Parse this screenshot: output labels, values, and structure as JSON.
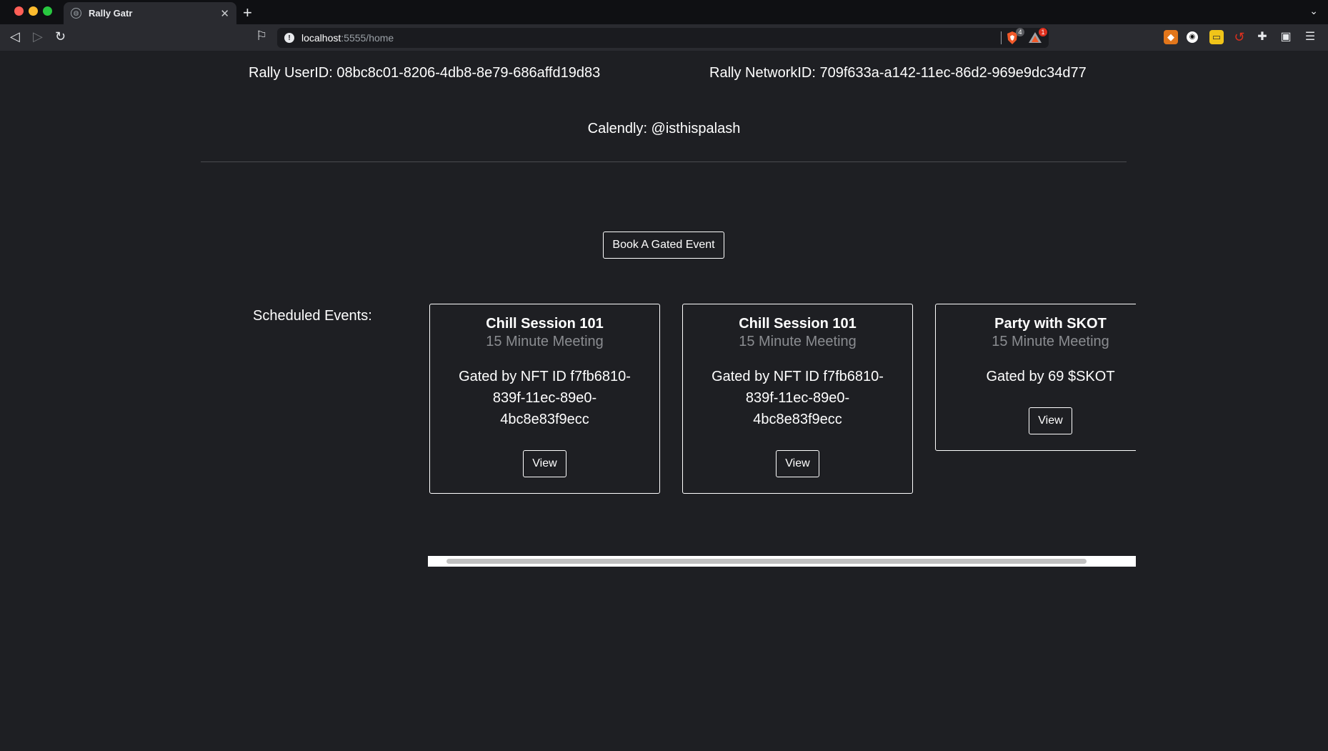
{
  "browser": {
    "tab_title": "Rally Gatr",
    "url_host": "localhost",
    "url_path": ":5555/home",
    "shield_count": "4",
    "rewards_count": "1"
  },
  "page": {
    "user_id_text": "Rally UserID: 08bc8c01-8206-4db8-8e79-686affd19d83",
    "network_id_text": "Rally NetworkID: 709f633a-a142-11ec-86d2-969e9dc34d77",
    "calendly_text": "Calendly: @isthispalash",
    "book_button_label": "Book A Gated Event",
    "scheduled_label": "Scheduled Events:"
  },
  "events": [
    {
      "title": "Chill Session 101",
      "subtitle": "15 Minute Meeting",
      "gate": "Gated by NFT ID f7fb6810-839f-11ec-89e0-4bc8e83f9ecc",
      "view_label": "View"
    },
    {
      "title": "Chill Session 101",
      "subtitle": "15 Minute Meeting",
      "gate": "Gated by NFT ID f7fb6810-839f-11ec-89e0-4bc8e83f9ecc",
      "view_label": "View"
    },
    {
      "title": "Party with SKOT",
      "subtitle": "15 Minute Meeting",
      "gate": "Gated by 69 $SKOT",
      "view_label": "View"
    }
  ],
  "colors": {
    "page_bg": "#1e1f23",
    "muted_text": "#8a8c90",
    "brave_orange": "#f1592a"
  }
}
